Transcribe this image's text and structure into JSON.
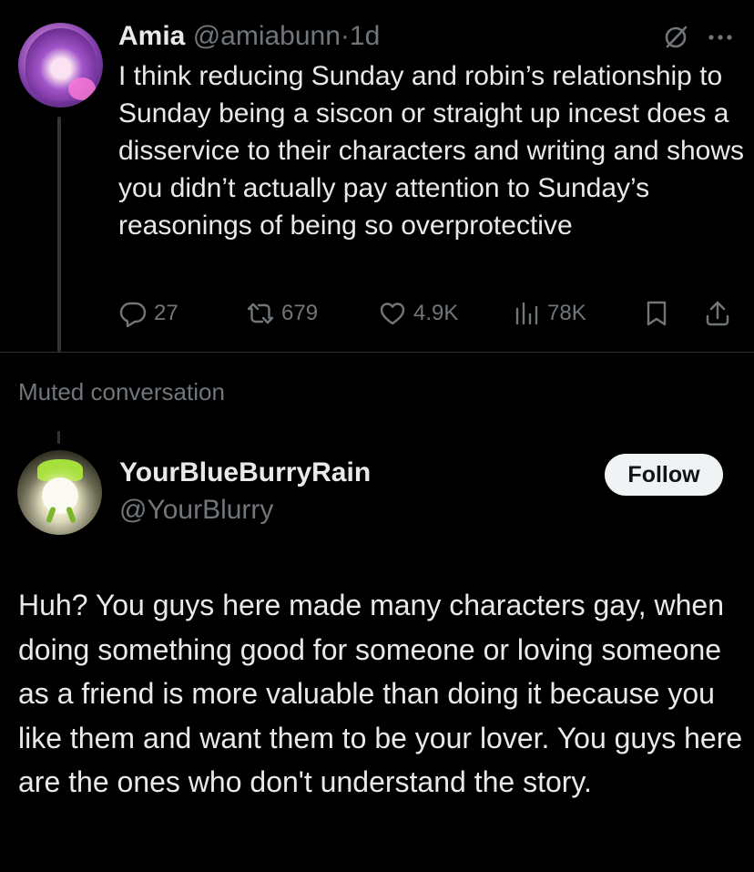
{
  "tweet1": {
    "name": "Amia",
    "handle": "@amiabunn",
    "dot": "·",
    "time": "1d",
    "text": "I think reducing Sunday and robin’s relationship to Sunday being a siscon or straight up incest does a disservice to their characters and writing and shows you didn’t actually pay attention to Sunday’s reasonings of being so overprotective",
    "metrics": {
      "replies": "27",
      "reposts": "679",
      "likes": "4.9K",
      "views": "78K"
    },
    "icons": [
      "grok-icon",
      "more-icon",
      "reply-icon",
      "repost-icon",
      "like-icon",
      "views-icon",
      "bookmark-icon",
      "share-icon"
    ]
  },
  "muted_label": "Muted conversation",
  "tweet2": {
    "name": "YourBlueBurryRain",
    "handle": "@YourBlurry",
    "follow_label": "Follow",
    "text": "Huh? You guys here made many characters gay, when doing something good for someone or loving someone as a friend is more valuable than doing it because you like them and want them to be your lover. You guys here are the ones who don't understand the story."
  },
  "colors": {
    "background": "#000000",
    "text": "#e7e9ea",
    "secondary": "#71767b",
    "divider": "#2f3336",
    "button_bg": "#eff3f4"
  }
}
